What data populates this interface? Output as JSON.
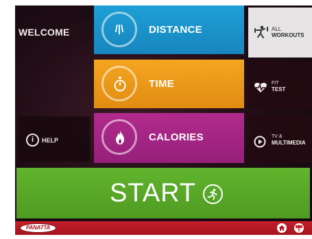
{
  "colors": {
    "distance": "#1e9fd6",
    "time": "#f4a521",
    "calories": "#b12a8d",
    "start": "#62b42d",
    "bottom_bar": "#c41f2b",
    "background": "#1e0c14"
  },
  "welcome": {
    "label": "WELCOME"
  },
  "help": {
    "icon": "info-icon",
    "icon_glyph": "i",
    "label": "HELP"
  },
  "modes": [
    {
      "label": "DISTANCE",
      "icon": "distance-road-icon",
      "icon_glyph": "/|\\"
    },
    {
      "label": "TIME",
      "icon": "stopwatch-icon"
    },
    {
      "label": "CALORIES",
      "icon": "flame-icon"
    }
  ],
  "side": [
    {
      "small": "ALL",
      "big": "WORKOUTS",
      "icon": "workout-figure-icon"
    },
    {
      "small": "FIT",
      "big": "TEST",
      "icon": "heart-pulse-icon"
    },
    {
      "small": "TV &",
      "big": "MULTIMEDIA",
      "icon": "play-icon"
    }
  ],
  "start": {
    "label": "START",
    "icon": "runner-icon"
  },
  "bottom_bar": {
    "logo": "PANATTA",
    "home_icon": "home-icon",
    "emblem_icon": "flag-emblem-icon"
  }
}
